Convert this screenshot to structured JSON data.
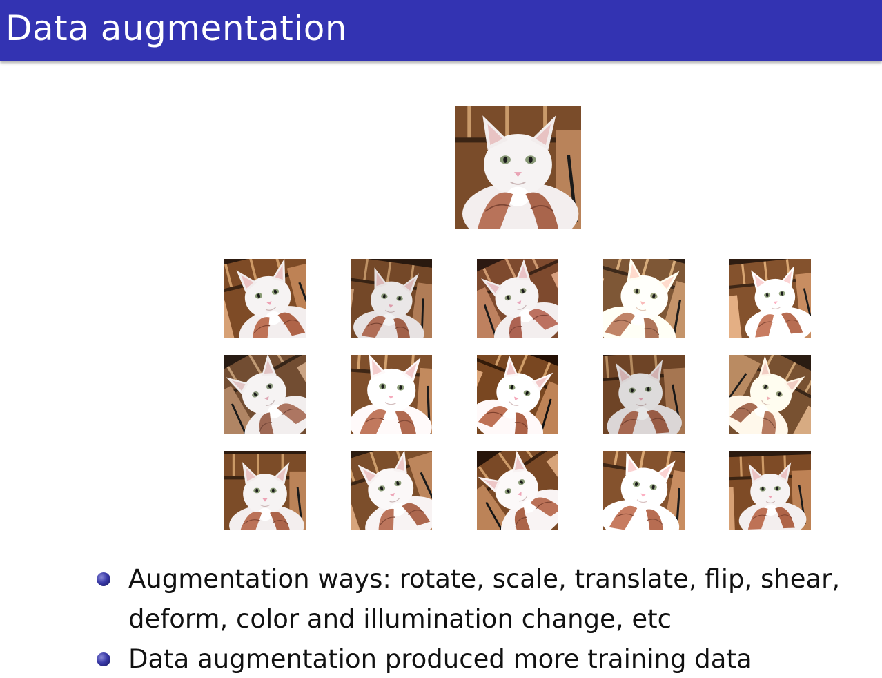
{
  "slide": {
    "title": "Data augmentation"
  },
  "images": {
    "original": {
      "subject": "white-cat-photo"
    },
    "augmented_rows": 3,
    "augmented_cols": 5
  },
  "bullets": [
    {
      "text": "Augmentation ways: rotate, scale, translate, flip, shear, deform, color and illumination change, etc"
    },
    {
      "text": "Data augmentation produced more training data"
    }
  ],
  "colors": {
    "title_bar": "#3333b2",
    "title_text": "#ffffff",
    "bullet": "#3a3aa8"
  }
}
